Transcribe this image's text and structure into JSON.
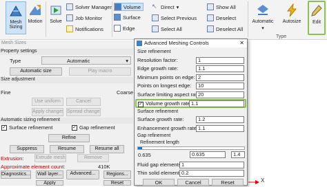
{
  "ribbon": {
    "mesh_sizing": "Mesh Sizing",
    "motion": "Motion",
    "solve": "Solve",
    "solver_manager": "Solver Manager",
    "job_monitor": "Job Monitor",
    "notifications": "Notifications",
    "volume": "Volume",
    "surface": "Surface",
    "edge": "Edge",
    "direct": "Direct",
    "select_previous": "Select Previous",
    "select_all": "Select All",
    "show_all": "Show All",
    "deselect": "Deselect",
    "deselect_all": "Deselect All",
    "automatic": "Automatic",
    "autosize": "Autosize",
    "edit": "Edit",
    "group_type": "Type"
  },
  "left_panel": {
    "title": "Mesh Sizes",
    "property_settings": "Property settings",
    "type_label": "Type",
    "type_value": "Automatic",
    "automatic_size": "Automatic size",
    "play_macro": "Play macro",
    "size_adjustment": "Size adjustment",
    "fine": "Fine",
    "coarse": "Coarse",
    "use_uniform": "Use uniform",
    "cancel": "Cancel",
    "apply_changes": "Apply changes",
    "spread_changes": "Spread changes",
    "automatic_sizing_refinement": "Automatic sizing refinement",
    "surface_refinement": "Surface refinement",
    "gap_refinement": "Gap refinement",
    "refine": "Refine",
    "suppress": "Suppress",
    "resume": "Resume",
    "resume_all": "Resume all",
    "extrusion_label": "Extrusion:",
    "extrude_mesh": "Extrude mesh",
    "remove": "Remove",
    "approx_count_label": "Approximate element count:",
    "approx_count_value": "410K",
    "diagnostics": "Diagnostics...",
    "wall_layer": "Wall layer...",
    "advanced": "Advanced...",
    "regions": "Regions...",
    "apply": "Apply",
    "reset": "Reset"
  },
  "dialog": {
    "title": "Advanced Meshing Controls",
    "size_refinement": "Size refinement",
    "resolution_factor_label": "Resolution factor:",
    "resolution_factor": "1",
    "edge_growth_label": "Edge growth rate:",
    "edge_growth": "1.1",
    "min_points_edge_label": "Minimum points on edge:",
    "min_points_edge": "2",
    "points_longest_edge_label": "Points on longest edge:",
    "points_longest_edge": "10",
    "surface_aspect_label": "Surface limiting aspect ratio:",
    "surface_aspect": "20",
    "volume_growth_label": "Volume growth rate:",
    "volume_growth": "1.1",
    "surface_refinement": "Surface refinement",
    "surface_growth_label": "Surface growth rate:",
    "surface_growth": "1.2",
    "enhancement_growth_label": "Enhancement growth rate:",
    "enhancement_growth": "1.1",
    "gap_refinement": "Gap refinement",
    "refinement_length": "Refinement length",
    "slider_min": "0.635",
    "slider_value": "0.635",
    "slider_max": "1.4",
    "fluid_gap_label": "Fluid gap elements:",
    "fluid_gap": "1",
    "thin_solid_label": "Thin solid elements:",
    "thin_solid": "0.2",
    "ok": "OK",
    "cancel": "Cancel",
    "reset": "Reset"
  },
  "graphics": {
    "axis_x": "X"
  }
}
